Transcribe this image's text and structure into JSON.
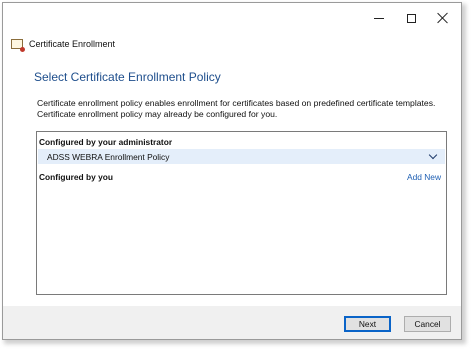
{
  "window": {
    "controls": {
      "minimize": "minimize-icon",
      "maximize": "maximize-icon",
      "close": "close-icon"
    }
  },
  "app": {
    "title": "Certificate Enrollment",
    "icon": "certificate-icon"
  },
  "page": {
    "title": "Select Certificate Enrollment Policy",
    "description": "Certificate enrollment policy enables enrollment for certificates based on predefined certificate templates. Certificate enrollment policy may already be configured for you."
  },
  "policies": {
    "admin_header": "Configured by your administrator",
    "admin_items": [
      {
        "name": "ADSS WEBRA Enrollment Policy",
        "expand_icon": "chevron-down-icon"
      }
    ],
    "user_header": "Configured by you",
    "add_new_label": "Add New"
  },
  "footer": {
    "next_label": "Next",
    "cancel_label": "Cancel"
  }
}
